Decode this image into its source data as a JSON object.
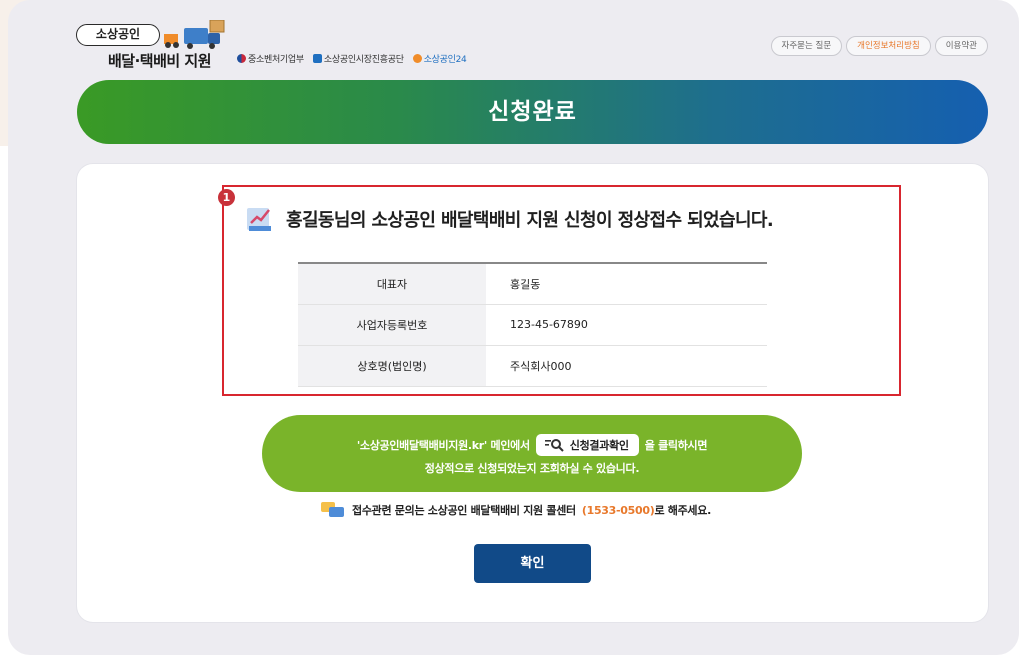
{
  "header": {
    "logo_pill": "소상공인",
    "logo_main": "배달·택배비 지원",
    "partners": [
      "중소벤처기업부",
      "소상공인시장진흥공단",
      "소상공인24"
    ],
    "links": [
      "자주묻는 질문",
      "개인정보처리방침",
      "이용약관"
    ]
  },
  "banner": {
    "title": "신청완료"
  },
  "result": {
    "badge": "1",
    "message": "홍길동님의 소상공인 배달택배비 지원 신청이 정상접수 되었습니다.",
    "rows": [
      {
        "label": "대표자",
        "value": "홍길동"
      },
      {
        "label": "사업자등록번호",
        "value": "123-45-67890"
      },
      {
        "label": "상호명(법인명)",
        "value": "주식회사000"
      }
    ]
  },
  "guide": {
    "line1_pre": "'소상공인배달택배비지원.kr' 메인에서",
    "button": "신청결과확인",
    "line1_post": "을 클릭하시면",
    "line2": "정상적으로 신청되었는지 조회하실 수 있습니다."
  },
  "inquiry": {
    "pre": "접수관련 문의는 소상공인 배달택배비 지원 콜센터",
    "phone": "(1533-0500)",
    "post": "로 해주세요."
  },
  "confirm_label": "확인",
  "colors": {
    "red": "#d8262f",
    "green": "#7ab42a",
    "navy": "#114a88",
    "orange": "#e8792c"
  }
}
